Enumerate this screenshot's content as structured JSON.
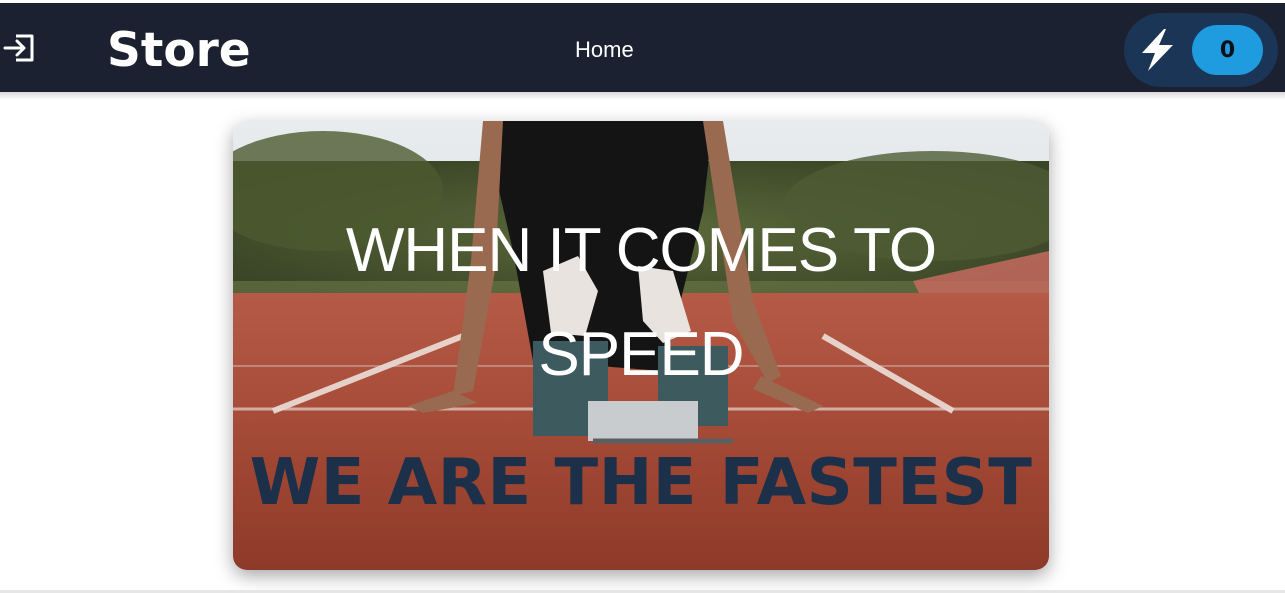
{
  "navbar": {
    "login_icon": "login-icon",
    "brand": "Store",
    "home_label": "Home",
    "bolt_icon": "lightning-bolt-icon",
    "cart_count": "0",
    "colors": {
      "bar": "#1b2130",
      "pill": "#1a3556",
      "badge": "#1f9be0"
    }
  },
  "hero": {
    "headline": "WHEN IT COMES TO SPEED",
    "tagline": "WE ARE THE FASTEST",
    "image_icon": "sprinter-start-photo",
    "colors": {
      "headline": "#ffffff",
      "tagline": "#1c3049"
    }
  }
}
